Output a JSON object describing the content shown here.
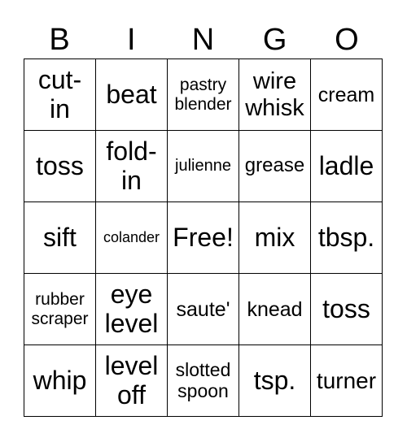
{
  "header": [
    "B",
    "I",
    "N",
    "G",
    "O"
  ],
  "rows": [
    [
      "cut-\nin",
      "beat",
      "pastry\nblender",
      "wire\nwhisk",
      "cream"
    ],
    [
      "toss",
      "fold-\nin",
      "julienne",
      "grease",
      "ladle"
    ],
    [
      "sift",
      "colander",
      "Free!",
      "mix",
      "tbsp."
    ],
    [
      "rubber\nscraper",
      "eye\nlevel",
      "saute'",
      "knead",
      "toss"
    ],
    [
      "whip",
      "level\noff",
      "slotted\nspoon",
      "tsp.",
      "turner"
    ]
  ]
}
